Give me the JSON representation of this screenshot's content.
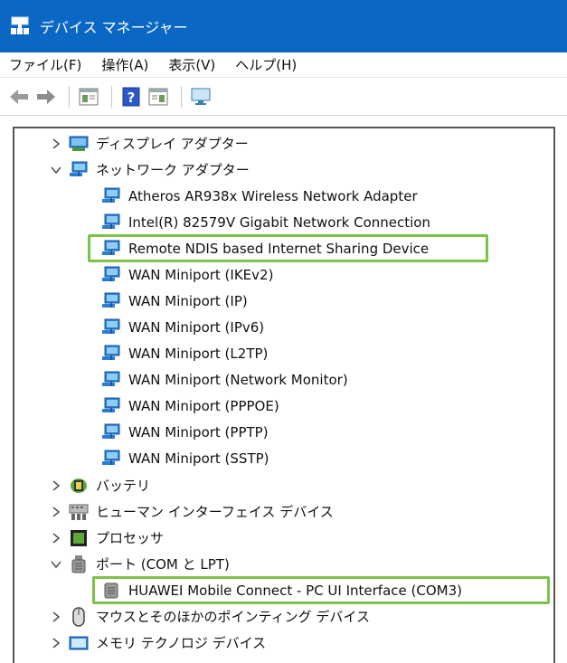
{
  "window": {
    "title": "デバイス マネージャー",
    "icon": "device-manager-icon"
  },
  "menu": [
    "ファイル(F)",
    "操作(A)",
    "表示(V)",
    "ヘルプ(H)"
  ],
  "toolbar": [
    "back-icon",
    "forward-icon",
    "properties-icon",
    "help-icon",
    "update-icon",
    "scan-hardware-icon"
  ],
  "tree": {
    "display_adapters": "ディスプレイ アダプター",
    "network_adapters": "ネットワーク アダプター",
    "network_items": [
      "Atheros AR938x Wireless Network Adapter",
      "Intel(R) 82579V Gigabit Network Connection",
      "Remote NDIS based Internet Sharing Device",
      "WAN Miniport (IKEv2)",
      "WAN Miniport (IP)",
      "WAN Miniport (IPv6)",
      "WAN Miniport (L2TP)",
      "WAN Miniport (Network Monitor)",
      "WAN Miniport (PPPOE)",
      "WAN Miniport (PPTP)",
      "WAN Miniport (SSTP)"
    ],
    "battery": "バッテリ",
    "hid": "ヒューマン インターフェイス デバイス",
    "processor": "プロセッサ",
    "ports": "ポート (COM と LPT)",
    "port_items": [
      "HUAWEI Mobile Connect - PC UI Interface (COM3)"
    ],
    "mouse": "マウスとそのほかのポインティング デバイス",
    "memory": "メモリ テクノロジ デバイス"
  },
  "highlight_color": "#7fc24a"
}
